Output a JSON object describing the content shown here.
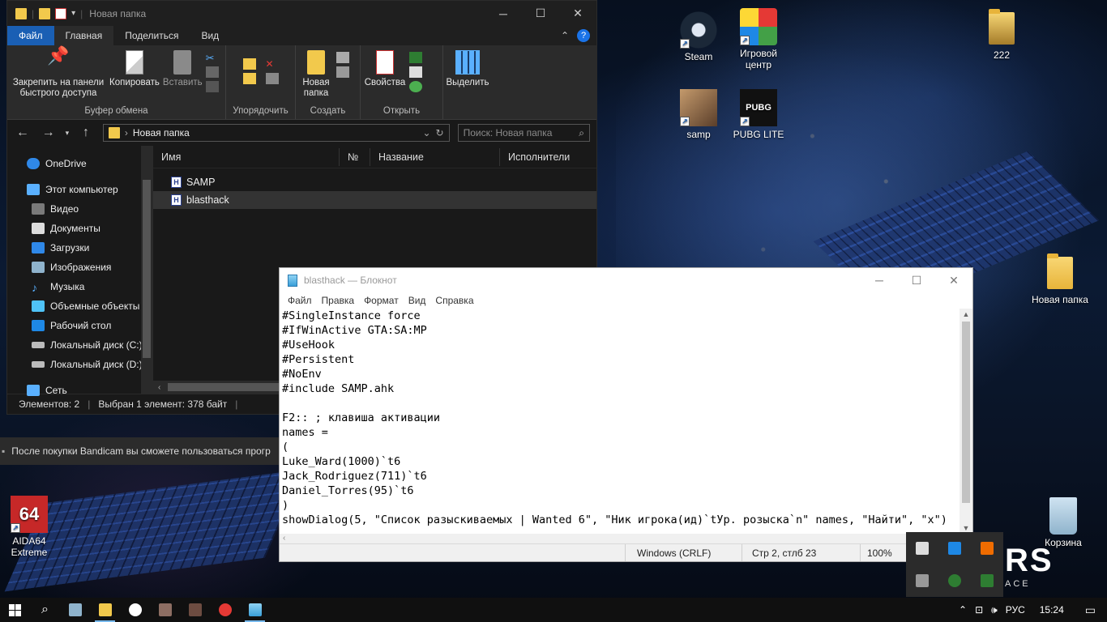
{
  "explorer": {
    "title": "Новая папка",
    "tabs": [
      "Файл",
      "Главная",
      "Поделиться",
      "Вид"
    ],
    "ribbon": {
      "clipboard": {
        "label": "Буфер обмена",
        "pin": "Закрепить на панели быстрого доступа",
        "copy": "Копировать",
        "paste": "Вставить"
      },
      "organize": {
        "label": "Упорядочить"
      },
      "new": {
        "label": "Создать",
        "new_folder": "Новая папка"
      },
      "open": {
        "label": "Открыть",
        "properties": "Свойства"
      },
      "select": {
        "label": "Выделить"
      }
    },
    "address": {
      "path": "Новая папка",
      "search_placeholder": "Поиск: Новая папка"
    },
    "nav": [
      {
        "label": "OneDrive",
        "icon": "onedrive-icon"
      },
      {
        "label": "Этот компьютер",
        "icon": "computer-icon"
      },
      {
        "label": "Видео",
        "icon": "video-icon"
      },
      {
        "label": "Документы",
        "icon": "documents-icon"
      },
      {
        "label": "Загрузки",
        "icon": "downloads-icon"
      },
      {
        "label": "Изображения",
        "icon": "pictures-icon"
      },
      {
        "label": "Музыка",
        "icon": "music-icon"
      },
      {
        "label": "Объемные объекты",
        "icon": "3d-objects-icon"
      },
      {
        "label": "Рабочий стол",
        "icon": "desktop-icon"
      },
      {
        "label": "Локальный диск (C:)",
        "icon": "drive-icon"
      },
      {
        "label": "Локальный диск (D:)",
        "icon": "drive-icon"
      },
      {
        "label": "Сеть",
        "icon": "network-icon"
      }
    ],
    "columns": [
      "Имя",
      "№",
      "Название",
      "Исполнители"
    ],
    "files": [
      {
        "name": "SAMP",
        "icon": "ahk-script-icon"
      },
      {
        "name": "blasthack",
        "icon": "ahk-script-icon"
      }
    ],
    "status": {
      "count": "Элементов: 2",
      "selection": "Выбран 1 элемент: 378 байт"
    }
  },
  "notice": {
    "text": "После покупки Bandicam вы сможете пользоваться прогр"
  },
  "notepad": {
    "title": "blasthack — Блокнот",
    "menu": [
      "Файл",
      "Правка",
      "Формат",
      "Вид",
      "Справка"
    ],
    "content": "#SingleInstance force\n#IfWinActive GTA:SA:MP\n#UseHook\n#Persistent\n#NoEnv\n#include SAMP.ahk\n\nF2:: ; клавиша активации\nnames =\n(\nLuke_Ward(1000)`t6\nJack_Rodriguez(711)`t6\nDaniel_Torres(95)`t6\n)\nshowDialog(5, \"Список разыскиваемых | Wanted 6\", \"Ник игрока(ид)`tУр. розыска`n\" names, \"Найти\", \"x\")",
    "status": {
      "eol": "Windows (CRLF)",
      "position": "Стр 2, стлб 23",
      "zoom": "100%"
    }
  },
  "desktop": {
    "icons": [
      {
        "label": "Steam",
        "icon": "steam-icon"
      },
      {
        "label": "Игровой центр",
        "icon": "game-center-icon"
      },
      {
        "label": "222",
        "icon": "folder-icon"
      },
      {
        "label": "samp",
        "icon": "samp-icon"
      },
      {
        "label": "PUBG LITE",
        "icon": "pubg-lite-icon"
      },
      {
        "label": "Новая папка",
        "icon": "folder-icon"
      },
      {
        "label": "AIDA64 Extreme",
        "icon": "aida64-icon"
      },
      {
        "label": "Корзина",
        "icon": "recycle-bin-icon"
      }
    ],
    "brand": "RS",
    "brand_sub": "ACE"
  },
  "taskbar": {
    "language": "РУС",
    "time": "15:24"
  },
  "colors": {
    "accent": "#1a5fb4",
    "explorer_bg": "#191919",
    "taskbar_bg": "#101010"
  }
}
